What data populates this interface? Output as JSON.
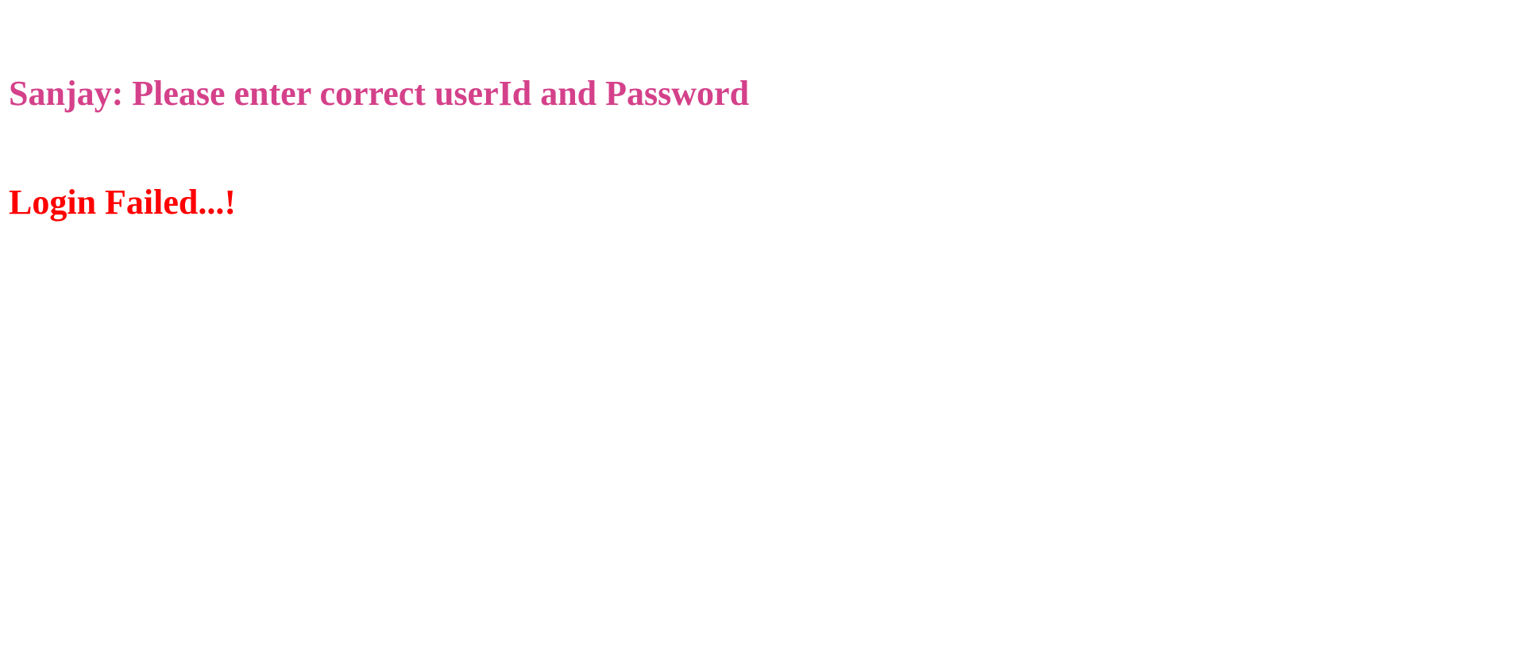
{
  "messages": {
    "user_prompt": {
      "text": "Sanjay: Please enter correct userId and Password",
      "color": "#d4418a"
    },
    "status": {
      "text": "Login Failed...!",
      "color": "#ff0000"
    }
  }
}
